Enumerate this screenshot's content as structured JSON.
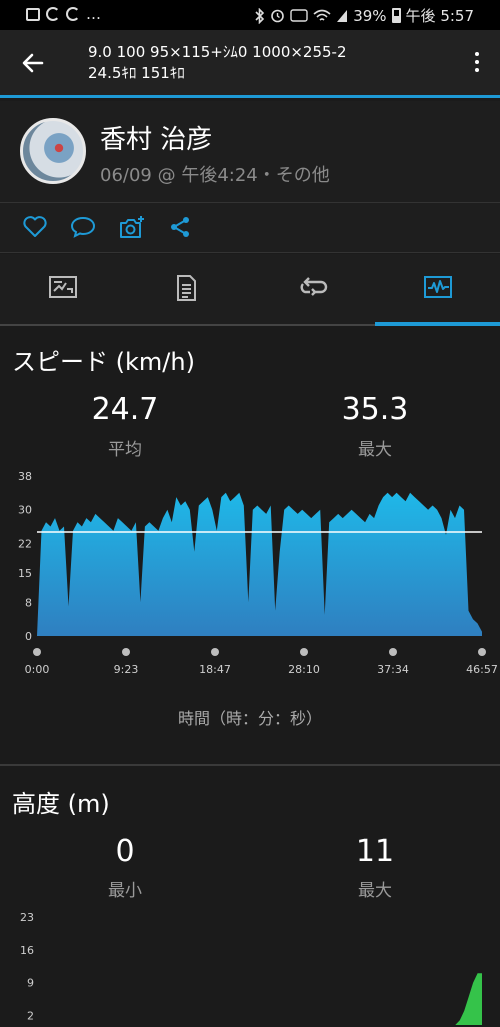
{
  "status_bar": {
    "battery": "39%",
    "time": "午後 5:57"
  },
  "header": {
    "title_line1": "9.0 100 95×115+ｼﾑ0 1000×255-2",
    "title_line2": "24.5ｷﾛ 151ｷﾛ"
  },
  "profile": {
    "name": "香村 治彦",
    "meta": "06/09 @ 午後4:24・その他"
  },
  "speed": {
    "title": "スピード (km/h)",
    "avg_value": "24.7",
    "avg_label": "平均",
    "max_value": "35.3",
    "max_label": "最大",
    "x_caption": "時間（時：分：秒）"
  },
  "altitude": {
    "title": "高度 (m)",
    "min_value": "0",
    "min_label": "最小",
    "max_value": "11",
    "max_label": "最大"
  },
  "colors": {
    "accent": "#1e9ad6",
    "area_top": "#1fb8e8",
    "area_bottom": "#2f7fc0",
    "alt_green": "#35c34a"
  },
  "chart_data": [
    {
      "type": "area",
      "title": "スピード (km/h)",
      "xlabel": "時間（時：分：秒）",
      "x_ticks": [
        "0:00",
        "9:23",
        "18:47",
        "28:10",
        "37:34",
        "46:57"
      ],
      "y_ticks": [
        "38",
        "30",
        "22",
        "15",
        "8",
        "0"
      ],
      "ylim": [
        0,
        38
      ],
      "avg_line": 24.7,
      "series": [
        {
          "values": [
            0,
            25,
            27,
            26,
            28,
            25,
            26,
            7,
            25,
            27,
            26,
            28,
            27,
            29,
            28,
            27,
            26,
            25,
            28,
            27,
            26,
            25,
            27,
            8,
            26,
            27,
            26,
            25,
            28,
            30,
            27,
            33,
            31,
            32,
            30,
            20,
            31,
            32,
            33,
            30,
            25,
            33,
            34,
            32,
            33,
            34,
            31,
            8,
            30,
            31,
            30,
            29,
            31,
            6,
            20,
            30,
            31,
            30,
            29,
            30,
            29,
            28,
            29,
            30,
            5,
            27,
            28,
            29,
            28,
            29,
            30,
            29,
            28,
            27,
            29,
            28,
            31,
            33,
            34,
            33,
            34,
            33,
            32,
            34,
            33,
            32,
            31,
            30,
            31,
            30,
            28,
            24,
            30,
            28,
            31,
            30,
            6,
            4,
            3,
            1
          ]
        }
      ]
    },
    {
      "type": "area",
      "title": "高度 (m)",
      "y_ticks": [
        "23",
        "16",
        "9",
        "2"
      ],
      "ylim": [
        0,
        23
      ],
      "series": [
        {
          "values": [
            0,
            0,
            0,
            0,
            0,
            0,
            0,
            0,
            0,
            0,
            0,
            0,
            0,
            0,
            0,
            0,
            0,
            0,
            0,
            0,
            0,
            0,
            0,
            0,
            0,
            0,
            0,
            0,
            0,
            0,
            0,
            0,
            0,
            0,
            0,
            0,
            0,
            0,
            0,
            0,
            0,
            0,
            0,
            0,
            0,
            0,
            0,
            0,
            0,
            0,
            0,
            0,
            0,
            0,
            0,
            0,
            0,
            0,
            0,
            0,
            0,
            0,
            0,
            0,
            0,
            0,
            0,
            0,
            0,
            0,
            0,
            0,
            0,
            0,
            0,
            0,
            0,
            0,
            0,
            0,
            0,
            0,
            0,
            0,
            0,
            0,
            0,
            0,
            0,
            0,
            0,
            0,
            0,
            0,
            1,
            3,
            6,
            9,
            11,
            11
          ]
        }
      ]
    }
  ]
}
